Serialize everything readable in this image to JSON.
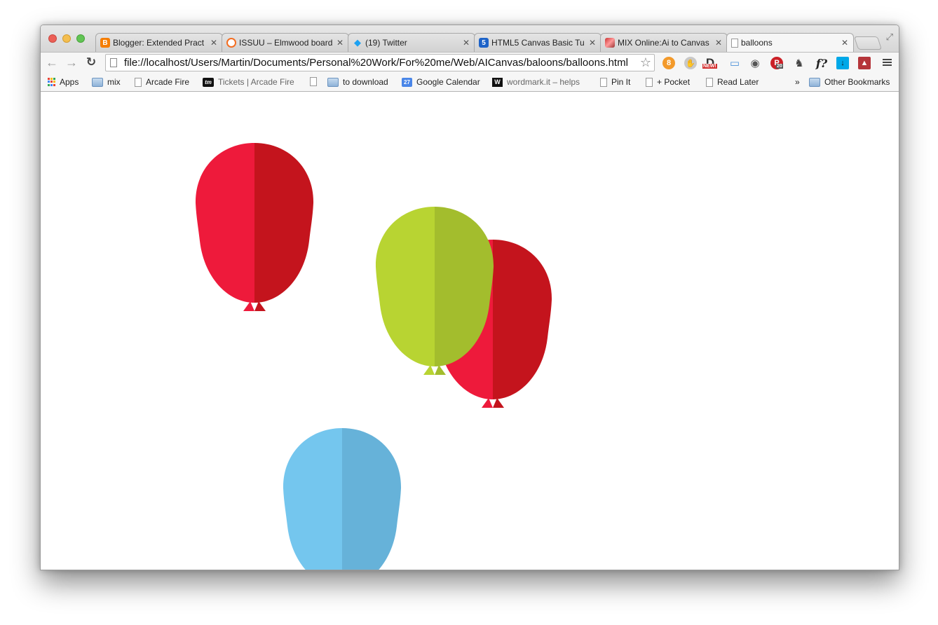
{
  "window": {
    "tabs": [
      {
        "title": "Blogger: Extended Pract",
        "icon": "blogger-icon",
        "color": "#f57d00",
        "glyph": "B"
      },
      {
        "title": "ISSUU – Elmwood board",
        "icon": "issuu-icon",
        "color": "#f36d21",
        "glyph": "◎"
      },
      {
        "title": "(19) Twitter",
        "icon": "twitter-icon",
        "color": "#1da1f2",
        "glyph": "🐦"
      },
      {
        "title": "HTML5 Canvas Basic Tu",
        "icon": "html5-icon",
        "color": "#1e63c8",
        "glyph": "5"
      },
      {
        "title": "MIX Online:Ai to Canvas",
        "icon": "mix-online-icon",
        "color": "#c33",
        "glyph": "M"
      },
      {
        "title": "balloons",
        "icon": "page-icon",
        "color": "#ffffff",
        "glyph": ""
      }
    ],
    "close_glyph": "✕"
  },
  "toolbar": {
    "back_glyph": "←",
    "forward_glyph": "→",
    "reload_glyph": "C",
    "url": "file://localhost/Users/Martin/Documents/Personal%20Work/For%20me/Web/AICanvas/baloons/balloons.html",
    "star_glyph": "☆",
    "extensions": [
      {
        "name": "extension-orange-icon",
        "color": "#f39a2b",
        "glyph": "8"
      },
      {
        "name": "extension-hand-icon",
        "color": "#9a9a9a",
        "glyph": "✋"
      },
      {
        "name": "extension-d-new-icon",
        "color": "#333333",
        "glyph": "D"
      },
      {
        "name": "extension-screen-icon",
        "color": "#4a90d9",
        "glyph": "▭"
      },
      {
        "name": "extension-camera-icon",
        "color": "#555555",
        "glyph": "◉"
      },
      {
        "name": "extension-pinterest-icon",
        "color": "#cb2027",
        "glyph": "P"
      },
      {
        "name": "extension-evernote-icon",
        "color": "#444444",
        "glyph": "E"
      },
      {
        "name": "extension-font-icon",
        "color": "#222222",
        "glyph": "f?"
      },
      {
        "name": "extension-download-icon",
        "color": "#00a8e8",
        "glyph": "↓"
      },
      {
        "name": "extension-red-icon",
        "color": "#b5353a",
        "glyph": "▲"
      }
    ],
    "new_badge": "NEW!",
    "pinterest_count": "20"
  },
  "bookmarks": {
    "items": [
      {
        "label": "Apps",
        "type": "apps"
      },
      {
        "label": "mix",
        "type": "folder"
      },
      {
        "label": "Arcade Fire",
        "type": "page"
      },
      {
        "label": "Tickets | Arcade Fire",
        "type": "tm"
      },
      {
        "label": "",
        "type": "page"
      },
      {
        "label": "to download",
        "type": "folder"
      },
      {
        "label": "Google Calendar",
        "type": "calendar"
      },
      {
        "label": "wordmark.it – helps",
        "type": "wordmark"
      },
      {
        "label": "Pin It",
        "type": "page"
      },
      {
        "label": "+ Pocket",
        "type": "page"
      },
      {
        "label": "Read Later",
        "type": "page"
      }
    ],
    "overflow_glyph": "»",
    "other": "Other Bookmarks",
    "calendar_day": "27"
  },
  "canvas": {
    "balloons": [
      {
        "name": "balloon-red-1",
        "left_color": "#ee1a3b",
        "right_color": "#c4141d"
      },
      {
        "name": "balloon-red-2",
        "left_color": "#ee1a3b",
        "right_color": "#c4141d"
      },
      {
        "name": "balloon-green",
        "left_color": "#b8d432",
        "right_color": "#a3bd2d"
      },
      {
        "name": "balloon-blue",
        "left_color": "#74c6ee",
        "right_color": "#66b2d9"
      }
    ]
  }
}
